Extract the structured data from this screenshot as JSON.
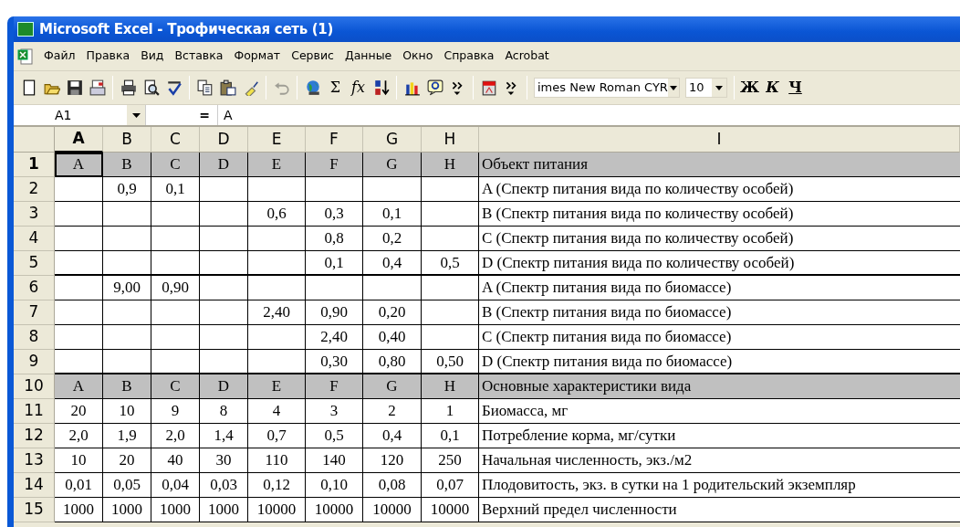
{
  "window": {
    "title": "Microsoft Excel - Трофическая сеть (1)"
  },
  "menu": [
    "Файл",
    "Правка",
    "Вид",
    "Вставка",
    "Формат",
    "Сервис",
    "Данные",
    "Окно",
    "Справка",
    "Acrobat"
  ],
  "toolbar_groups": [
    [
      {
        "kind": "new",
        "disabled": false
      },
      {
        "kind": "open",
        "disabled": false
      },
      {
        "kind": "save",
        "disabled": false
      },
      {
        "kind": "permission",
        "disabled": false
      }
    ],
    [
      {
        "kind": "print",
        "disabled": false
      },
      {
        "kind": "preview",
        "disabled": false
      },
      {
        "kind": "spelling",
        "disabled": false
      }
    ],
    [
      {
        "kind": "copy",
        "disabled": false
      },
      {
        "kind": "paste",
        "disabled": false
      },
      {
        "kind": "brush",
        "disabled": false
      }
    ],
    [
      {
        "kind": "undo",
        "disabled": true
      }
    ],
    [
      {
        "kind": "globe",
        "disabled": false
      },
      {
        "kind": "text",
        "label": "Σ",
        "disabled": false
      },
      {
        "kind": "text",
        "label": "fx",
        "disabled": false
      },
      {
        "kind": "sort",
        "disabled": false
      }
    ],
    [
      {
        "kind": "chart",
        "disabled": false
      },
      {
        "kind": "help",
        "disabled": false
      },
      {
        "kind": "more",
        "disabled": false
      }
    ],
    [
      {
        "kind": "pdf",
        "disabled": false
      },
      {
        "kind": "more",
        "disabled": false
      }
    ],
    [
      {
        "kind": "font",
        "value": "imes New Roman CYR",
        "disabled": false
      },
      {
        "kind": "size",
        "value": "10",
        "disabled": false
      }
    ],
    [
      {
        "kind": "bold",
        "label": "Ж",
        "disabled": false
      },
      {
        "kind": "italic",
        "label": "К",
        "disabled": false
      },
      {
        "kind": "underline",
        "label": "Ч",
        "disabled": false
      }
    ]
  ],
  "formula_bar": {
    "name_box": "A1",
    "equals": "=",
    "formula": "A"
  },
  "sheet": {
    "columns": [
      {
        "label": "A",
        "selected": true
      },
      {
        "label": "B",
        "selected": false
      },
      {
        "label": "C",
        "selected": false
      },
      {
        "label": "D",
        "selected": false
      },
      {
        "label": "E",
        "selected": false
      },
      {
        "label": "F",
        "selected": false
      },
      {
        "label": "G",
        "selected": false
      },
      {
        "label": "H",
        "selected": false
      },
      {
        "label": "I",
        "selected": false
      }
    ],
    "sections": [
      {
        "rows": [
          {
            "number": "1",
            "kind": "header",
            "selected": true,
            "cells": [
              "A",
              "B",
              "C",
              "D",
              "E",
              "F",
              "G",
              "H",
              "Объект питания"
            ]
          },
          {
            "number": "2",
            "kind": "data",
            "selected": false,
            "cells": [
              "",
              "0,9",
              "0,1",
              "",
              "",
              "",
              "",
              "",
              "A (Спектр питания вида по количеству особей)"
            ]
          },
          {
            "number": "3",
            "kind": "data",
            "selected": false,
            "cells": [
              "",
              "",
              "",
              "",
              "0,6",
              "0,3",
              "0,1",
              "",
              "B (Спектр питания вида по количеству особей)"
            ]
          },
          {
            "number": "4",
            "kind": "data",
            "selected": false,
            "cells": [
              "",
              "",
              "",
              "",
              "",
              "0,8",
              "0,2",
              "",
              "C (Спектр питания вида по количеству особей)"
            ]
          },
          {
            "number": "5",
            "kind": "data",
            "selected": false,
            "cells": [
              "",
              "",
              "",
              "",
              "",
              "0,1",
              "0,4",
              "0,5",
              "D (Спектр питания вида по количеству особей)"
            ]
          }
        ]
      },
      {
        "rows": [
          {
            "number": "6",
            "kind": "data",
            "selected": false,
            "cells": [
              "",
              "9,00",
              "0,90",
              "",
              "",
              "",
              "",
              "",
              "A (Спектр питания вида по биомассе)"
            ]
          },
          {
            "number": "7",
            "kind": "data",
            "selected": false,
            "cells": [
              "",
              "",
              "",
              "",
              "2,40",
              "0,90",
              "0,20",
              "",
              "B (Спектр питания вида по биомассе)"
            ]
          },
          {
            "number": "8",
            "kind": "data",
            "selected": false,
            "cells": [
              "",
              "",
              "",
              "",
              "",
              "2,40",
              "0,40",
              "",
              "C (Спектр питания вида по биомассе)"
            ]
          },
          {
            "number": "9",
            "kind": "data",
            "selected": false,
            "cells": [
              "",
              "",
              "",
              "",
              "",
              "0,30",
              "0,80",
              "0,50",
              "D (Спектр питания вида по биомассе)"
            ]
          }
        ]
      },
      {
        "rows": [
          {
            "number": "10",
            "kind": "header",
            "selected": false,
            "cells": [
              "A",
              "B",
              "C",
              "D",
              "E",
              "F",
              "G",
              "H",
              "Основные характеристики вида"
            ]
          },
          {
            "number": "11",
            "kind": "data",
            "selected": false,
            "cells": [
              "20",
              "10",
              "9",
              "8",
              "4",
              "3",
              "2",
              "1",
              "Биомасса, мг"
            ]
          },
          {
            "number": "12",
            "kind": "data",
            "selected": false,
            "cells": [
              "2,0",
              "1,9",
              "2,0",
              "1,4",
              "0,7",
              "0,5",
              "0,4",
              "0,1",
              "Потребление корма, мг/сутки"
            ]
          },
          {
            "number": "13",
            "kind": "data",
            "selected": false,
            "cells": [
              "10",
              "20",
              "40",
              "30",
              "110",
              "140",
              "120",
              "250",
              "Начальная численность, экз./м2"
            ]
          },
          {
            "number": "14",
            "kind": "data",
            "selected": false,
            "cells": [
              "0,01",
              "0,05",
              "0,04",
              "0,03",
              "0,12",
              "0,10",
              "0,08",
              "0,07",
              "Плодовитость, экз. в сутки на 1 родительский экземпляр"
            ]
          },
          {
            "number": "15",
            "kind": "data",
            "selected": false,
            "cells": [
              "1000",
              "1000",
              "1000",
              "1000",
              "10000",
              "10000",
              "10000",
              "10000",
              "Верхний предел численности"
            ]
          }
        ]
      }
    ]
  }
}
